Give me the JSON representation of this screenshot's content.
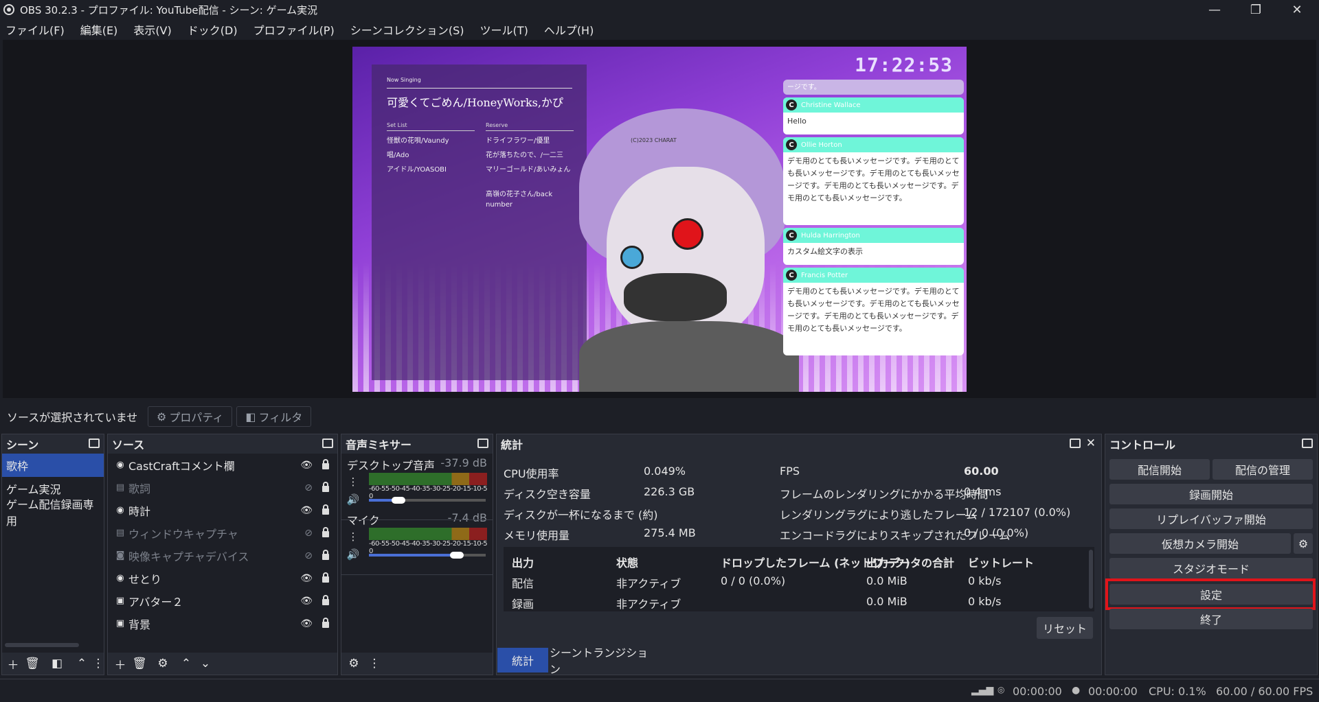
{
  "window": {
    "title": "OBS 30.2.3 - プロファイル: YouTube配信 - シーン: ゲーム実況",
    "minimize_glyph": "—",
    "maximize_glyph": "❐",
    "close_glyph": "✕"
  },
  "menu": [
    "ファイル(F)",
    "編集(E)",
    "表示(V)",
    "ドック(D)",
    "プロファイル(P)",
    "シーンコレクション(S)",
    "ツール(T)",
    "ヘルプ(H)"
  ],
  "preview": {
    "clock": "17:22:53",
    "now_singing_label": "Now Singing",
    "current_song": "可愛くてごめん/HoneyWorks,かぴ",
    "setlist_label": "Set List",
    "reserve_label": "Reserve",
    "setlist": [
      "怪獣の花唄/Vaundy",
      "唱/Ado",
      "アイドル/YOASOBI"
    ],
    "reserve": [
      "ドライフラワー/優里",
      "花が落ちたので、/一二三",
      "マリーゴールド/あいみょん",
      "高嶺の花子さん/back number"
    ],
    "copyright": "(C)2023 CHARAT",
    "chat_top": "ージです。",
    "chats": [
      {
        "name": "Christine Wallace",
        "text": "Hello"
      },
      {
        "name": "Ollie Horton",
        "text": "デモ用のとても長いメッセージです。デモ用のとても長いメッセージです。デモ用のとても長いメッセージです。デモ用のとても長いメッセージです。デモ用のとても長いメッセージです。"
      },
      {
        "name": "Hulda Harrington",
        "text": "カスタム絵文字の表示"
      },
      {
        "name": "Francis Potter",
        "text": "デモ用のとても長いメッセージです。デモ用のとても長いメッセージです。デモ用のとても長いメッセージです。デモ用のとても長いメッセージです。デモ用のとても長いメッセージです。"
      }
    ]
  },
  "source_toolbar": {
    "no_selection": "ソースが選択されていませ",
    "properties": "プロパティ",
    "filters": "フィルタ"
  },
  "scenes": {
    "title": "シーン",
    "items": [
      "歌枠",
      "ゲーム実況",
      "ゲーム配信録画専用"
    ],
    "active": "歌枠"
  },
  "sources": {
    "title": "ソース",
    "items": [
      {
        "name": "CastCraftコメント欄",
        "icon": "globe-icon",
        "visible": true
      },
      {
        "name": "歌詞",
        "icon": "window-icon",
        "visible": false
      },
      {
        "name": "時計",
        "icon": "globe-icon",
        "visible": true
      },
      {
        "name": "ウィンドウキャプチャ",
        "icon": "window-icon",
        "visible": false
      },
      {
        "name": "映像キャプチャデバイス",
        "icon": "camera-icon",
        "visible": false
      },
      {
        "name": "せとり",
        "icon": "globe-icon",
        "visible": true
      },
      {
        "name": "アバター２",
        "icon": "image-icon",
        "visible": true
      },
      {
        "name": "背景",
        "icon": "image-icon",
        "visible": true
      }
    ]
  },
  "mixer": {
    "title": "音声ミキサー",
    "scale": "-60-55-50-45-40-35-30-25-20-15-10-5 0",
    "channels": [
      {
        "name": "デスクトップ音声",
        "db": "-37.9 dB",
        "level": 0.25
      },
      {
        "name": "マイク",
        "db": "-7.4 dB",
        "level": 0.75
      }
    ]
  },
  "stats": {
    "title": "統計",
    "left": [
      {
        "label": "CPU使用率",
        "value": "0.049%"
      },
      {
        "label": "ディスク空き容量",
        "value": "226.3 GB"
      },
      {
        "label": "ディスクが一杯になるまで (約)",
        "value": ""
      },
      {
        "label": "メモリ使用量",
        "value": "275.4 MB"
      }
    ],
    "right": [
      {
        "label": "FPS",
        "value": "60.00"
      },
      {
        "label": "フレームのレンダリングにかかる平均時間",
        "value": "0.4 ms"
      },
      {
        "label": "レンダリングラグにより逃したフレーム",
        "value": "12 / 172107 (0.0%)"
      },
      {
        "label": "エンコードラグによりスキップされたフレーム",
        "value": "0 / 0 (0.0%)"
      }
    ],
    "table_headers": [
      "出力",
      "状態",
      "ドロップしたフレーム (ネットワーク)",
      "出力データの合計",
      "ビットレート"
    ],
    "table_rows": [
      [
        "配信",
        "非アクティブ",
        "0 / 0 (0.0%)",
        "0.0 MiB",
        "0 kb/s"
      ],
      [
        "録画",
        "非アクティブ",
        "",
        "0.0 MiB",
        "0 kb/s"
      ]
    ],
    "reset": "リセット",
    "tabs": [
      "統計",
      "シーントランジション"
    ]
  },
  "controls": {
    "title": "コントロール",
    "start_stream": "配信開始",
    "manage_stream": "配信の管理",
    "start_record": "録画開始",
    "replay_buffer": "リプレイバッファ開始",
    "virtual_cam": "仮想カメラ開始",
    "studio_mode": "スタジオモード",
    "settings": "設定",
    "exit": "終了"
  },
  "statusbar": {
    "stream_time": "00:00:00",
    "record_time": "00:00:00",
    "cpu": "CPU: 0.1%",
    "fps": "60.00 / 60.00 FPS"
  },
  "colors": {
    "accent": "#2a4fa8",
    "highlight_box": "#e0141a",
    "chat_header": "#6ff5d9"
  }
}
